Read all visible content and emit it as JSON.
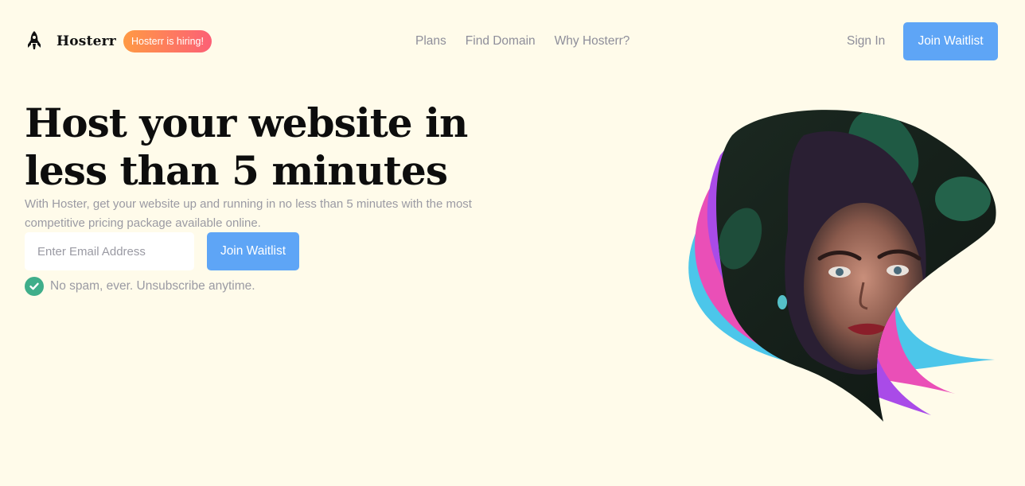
{
  "brand": {
    "name": "Hosterr",
    "badge": "Hosterr is hiring!",
    "logo_icon": "rocket-icon"
  },
  "nav": {
    "links": [
      "Plans",
      "Find Domain",
      "Why Hosterr?"
    ]
  },
  "header": {
    "sign_in": "Sign In",
    "join_label": "Join Waitlist"
  },
  "hero": {
    "headline": "Host your website in less than 5 minutes",
    "subtitle": "With Hoster, get your website up and running in no less than 5 minutes with the most competitive pricing package available online.",
    "email_placeholder": "Enter Email Address",
    "join_label": "Join Waitlist",
    "note": "No spam, ever. Unsubscribe anytime.",
    "note_icon": "check-circle-icon"
  },
  "colors": {
    "background": "#fffbea",
    "accent": "#5ea5f6",
    "badge_gradient": [
      "#ff9a44",
      "#fc6076"
    ],
    "check": "#3fae8a",
    "ribbon_blue": "#4cc6ea",
    "ribbon_pink": "#ea4fb7",
    "ribbon_purple": "#a94be8"
  }
}
